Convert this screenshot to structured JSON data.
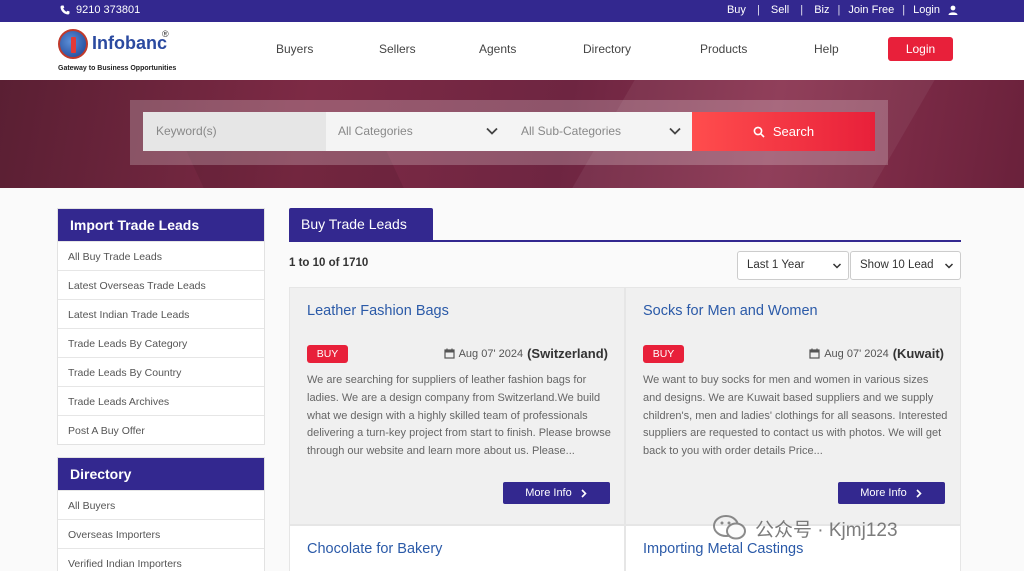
{
  "topbar": {
    "phone": "9210 373801",
    "links": [
      "Buy",
      "Sell",
      "Biz",
      "Join Free",
      "Login"
    ]
  },
  "header": {
    "logo_name": "Infobanc",
    "logo_reg": "®",
    "logo_tagline": "Gateway to Business Opportunities",
    "nav": [
      "Buyers",
      "Sellers",
      "Agents",
      "Directory",
      "Products",
      "Help"
    ],
    "login_label": "Login"
  },
  "search": {
    "keyword_placeholder": "Keyword(s)",
    "category": "All Categories",
    "subcategory": "All Sub-Categories",
    "button_label": "Search"
  },
  "sidebar": {
    "import_title": "Import Trade Leads",
    "import_items": [
      "All Buy Trade Leads",
      "Latest Overseas Trade Leads",
      "Latest Indian Trade Leads",
      "Trade Leads By Category",
      "Trade Leads By Country",
      "Trade Leads Archives",
      "Post A Buy Offer"
    ],
    "directory_title": "Directory",
    "directory_items": [
      "All Buyers",
      "Overseas Importers",
      "Verified Indian Importers"
    ]
  },
  "main": {
    "tab_label": "Buy Trade Leads",
    "result_count": "1 to 10 of 1710",
    "period_filter": "Last 1 Year",
    "show_filter": "Show 10 Lead",
    "cards": [
      {
        "title": "Leather Fashion Bags",
        "badge": "BUY",
        "date": "Aug 07' 2024",
        "country": "(Switzerland)",
        "desc": "We are searching for suppliers of leather fashion bags for ladies. We are a design company from Switzerland.We build what we design with a highly skilled team of professionals delivering a turn-key project from start to finish. Please browse through our website and learn more about us. Please...",
        "more_label": "More Info"
      },
      {
        "title": "Socks for Men and Women",
        "badge": "BUY",
        "date": "Aug 07' 2024",
        "country": "(Kuwait)",
        "desc": "We want to buy socks for men and women in various sizes and designs. We are Kuwait based suppliers and we supply children's, men and ladies' clothings for all seasons. Interested suppliers are requested to contact us with photos. We will get back to you with order details Price...",
        "more_label": "More Info"
      },
      {
        "title": "Chocolate for Bakery"
      },
      {
        "title": "Importing Metal Castings"
      }
    ]
  },
  "watermark": "公众号 · Kjmj123",
  "colors": {
    "primary": "#33288f",
    "accent": "#e8203a",
    "link": "#2b5aa8"
  }
}
